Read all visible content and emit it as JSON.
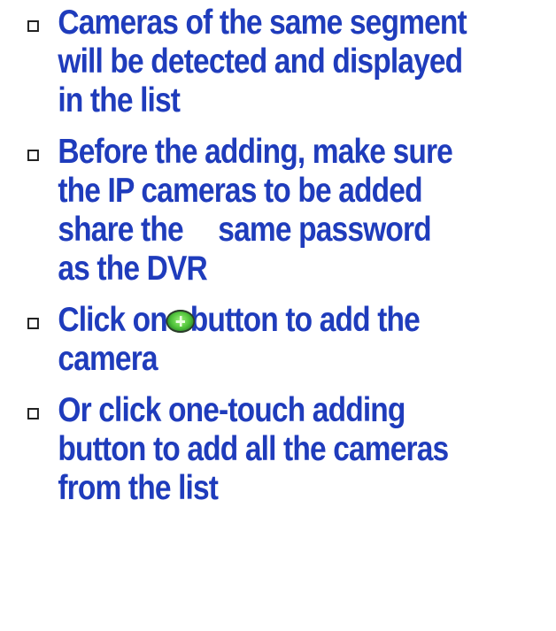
{
  "colors": {
    "text": "#1f3cbc",
    "bullet": "#222222",
    "background": "#ffffff",
    "add_icon": "#4fc23a"
  },
  "bullets": [
    {
      "lines": [
        "Cameras of the same segment",
        "will be detected and displayed",
        "in the list"
      ]
    },
    {
      "lines": [
        "Before the adding, make sure",
        "the IP cameras to be added",
        "share the",
        "same password",
        "as the DVR"
      ]
    },
    {
      "icon": "green-add-button-icon",
      "lines": [
        "Click on",
        "button to add the",
        "camera"
      ]
    },
    {
      "lines": [
        "Or click one-touch adding",
        "button to add all the cameras",
        "from the list"
      ]
    }
  ]
}
